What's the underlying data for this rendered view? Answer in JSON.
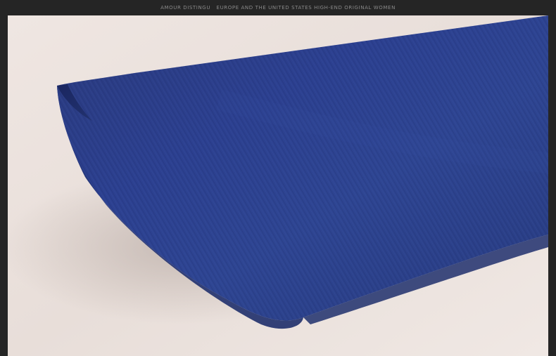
{
  "header": {
    "brand": "AMOUR DISTINGU",
    "tagline": "EUROPE AND THE UNITED STATES HIGH-END ORIGINAL WOMEN"
  },
  "colors": {
    "frame_background": "#252525",
    "header_text": "#8a8a8a",
    "backdrop": "#ede4df",
    "fabric": "#2a3d83",
    "fabric_shadow": "#1b2a66"
  }
}
